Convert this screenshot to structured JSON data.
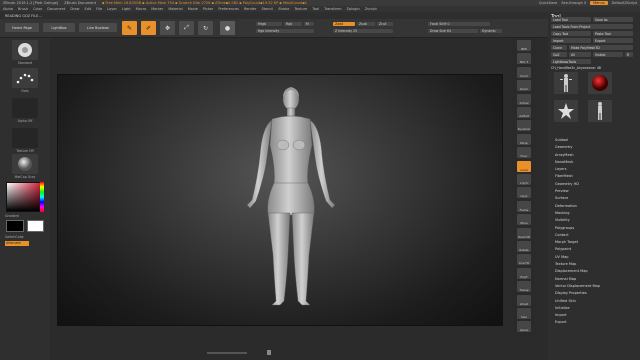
{
  "titlebar": {
    "app": "ZBrush 2019.1.2 [Piotr Colinge]",
    "document": "ZBrush Document",
    "stats": "▪ Free Mem 16.635GB ▪ Active Mem 794 ▪ Scratch Disk 2726 ▪ ATime▪0.082 ▪ PolyCount▪19.52 KP ▪ MeshCount▪1",
    "quicksave": "QuickSave",
    "seethrough": "See-through 0",
    "menus": "Menus",
    "script": "DefaultZScript"
  },
  "menubar": {
    "items": [
      "Alpha",
      "Brush",
      "Color",
      "Document",
      "Draw",
      "Edit",
      "File",
      "Layer",
      "Light",
      "Macro",
      "Marker",
      "Material",
      "Movie",
      "Picker",
      "Preferences",
      "Render",
      "Stencil",
      "Stroke",
      "Texture",
      "Tool",
      "Transform",
      "Zplugin",
      "Zscript"
    ]
  },
  "filebar": {
    "label": "READING GOZ FILE..."
  },
  "toolbar": {
    "home_page": "Home Page",
    "lightbox": "LightBox",
    "live_boolean": "Live Boolean",
    "edit": "Edit",
    "draw": "Draw",
    "move": "Move",
    "scale": "Scale",
    "rotate": "Rotate",
    "mrgb": "Mrgb",
    "rgb": "Rgb",
    "m": "M",
    "rgb_intensity": "Rgb Intensity",
    "zadd": "Zadd",
    "zsub": "Zsub",
    "zcut": "Zcut",
    "z_intensity": "Z Intensity 25",
    "focal_shift": "Focal Shift 0",
    "draw_size": "Draw Size 64",
    "dynamic": "Dynamic"
  },
  "left_shelf": {
    "items": [
      "Standard",
      "Dots",
      "Alpha Off",
      "Texture Off",
      "MatCap Gray"
    ],
    "gradient": "Gradient",
    "switch_color": "SwitchColor",
    "alternate": "Alternate"
  },
  "right_icons": [
    "BPR",
    "SPix 3",
    "Scroll",
    "Zoom",
    "Actual",
    "AAHalf",
    "Dynamic",
    "Persp",
    "Floor",
    "Local",
    "L.Sym",
    "Gxyz",
    "Frame",
    "Move",
    "Zoom3D",
    "Rotate",
    "Line Fill",
    "PolyF",
    "Transp",
    "Ghost",
    "Solo",
    "Xpose"
  ],
  "tool_panel": {
    "title": "Tool",
    "buttons": [
      "Load Tool",
      "Save As",
      "Load Tools From Project",
      "Copy Tool",
      "Paste Tool",
      "Import",
      "Export",
      "Clone",
      "Make PolyMesh3D",
      "GoZ",
      "All",
      "Visible",
      "R",
      "Lightbox▸Tools"
    ],
    "current_tool": "CH_Handflex3c_Anyoneone: 48",
    "thumbs": [
      "CH_Handflex3c",
      "SphereBrush",
      "AlphaBrush",
      "SimpleBrush",
      "EraserBrush",
      "PolyMesh3D",
      "CW_Compare"
    ],
    "subpalettes": [
      "Subtool",
      "Geometry",
      "ArrayMesh",
      "NanoMesh",
      "Layers",
      "FiberMesh",
      "Geometry HD",
      "Preview",
      "Surface",
      "Deformation",
      "Masking",
      "Visibility",
      "Polygroups",
      "Contact",
      "Morph Target",
      "Polypaint",
      "UV Map",
      "Texture Map",
      "Displacement Map",
      "Normal Map",
      "Vector Displacement Map",
      "Display Properties",
      "Unified Skin",
      "Initialize",
      "Import",
      "Export"
    ]
  },
  "colors": {
    "accent": "#e8902a",
    "panel": "#2e2e2e",
    "viewport": "#1d1d1d"
  }
}
